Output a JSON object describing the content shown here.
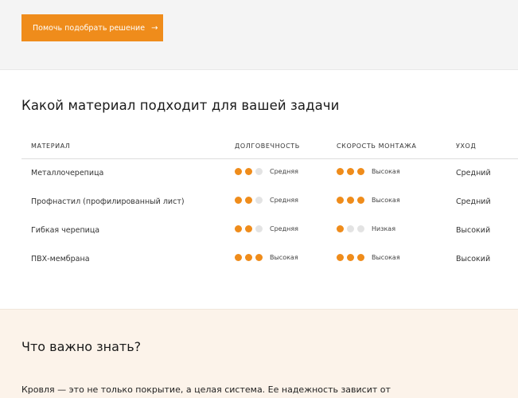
{
  "cta": {
    "label": "Помочь подобрать решение",
    "arrow": "→"
  },
  "section": {
    "title": "Какой материал подходит для вашей задачи"
  },
  "table": {
    "headers": {
      "material": "МАТЕРИАЛ",
      "durability": "ДОЛГОВЕЧНОСТЬ",
      "speed": "СКОРОСТЬ МОНТАЖА",
      "care": "УХОД"
    },
    "rows": [
      {
        "material": "Металлочерепица",
        "durability_level": 2,
        "durability_label": "Средняя",
        "speed_level": 3,
        "speed_label": "Высокая",
        "care": "Средний"
      },
      {
        "material": "Профнастил (профилированный лист)",
        "durability_level": 2,
        "durability_label": "Средняя",
        "speed_level": 3,
        "speed_label": "Высокая",
        "care": "Средний"
      },
      {
        "material": "Гибкая черепица",
        "durability_level": 2,
        "durability_label": "Средняя",
        "speed_level": 1,
        "speed_label": "Низкая",
        "care": "Высокий"
      },
      {
        "material": "ПВХ-мембрана",
        "durability_level": 3,
        "durability_label": "Высокая",
        "speed_level": 3,
        "speed_label": "Высокая",
        "care": "Высокий"
      }
    ]
  },
  "info": {
    "title": "Что важно знать?",
    "text": "Кровля — это не только покрытие, а целая система. Ее надежность зависит от"
  },
  "colors": {
    "accent": "#ef8c1b",
    "dot_off": "#e3e3e3",
    "info_bg": "#fcf3ea"
  }
}
